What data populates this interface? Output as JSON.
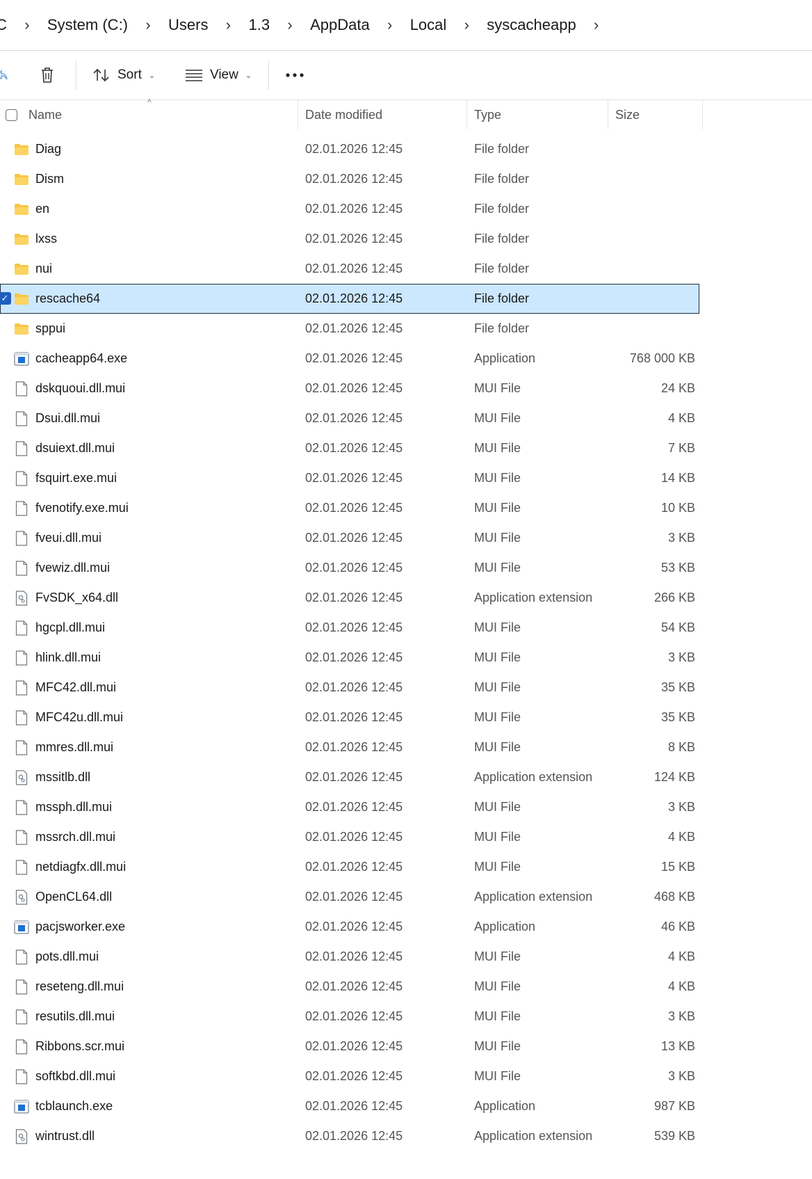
{
  "breadcrumb": {
    "cut_fragment": "C",
    "items": [
      "System (C:)",
      "Users",
      "1.3",
      "AppData",
      "Local",
      "syscacheapp"
    ]
  },
  "toolbar": {
    "sort_label": "Sort",
    "view_label": "View"
  },
  "columns": {
    "name": "Name",
    "date": "Date modified",
    "type": "Type",
    "size": "Size"
  },
  "files": [
    {
      "name": "Diag",
      "date": "02.01.2026 12:45",
      "type": "File folder",
      "size": "",
      "icon": "folder-icon"
    },
    {
      "name": "Dism",
      "date": "02.01.2026 12:45",
      "type": "File folder",
      "size": "",
      "icon": "folder-icon"
    },
    {
      "name": "en",
      "date": "02.01.2026 12:45",
      "type": "File folder",
      "size": "",
      "icon": "folder-icon"
    },
    {
      "name": "lxss",
      "date": "02.01.2026 12:45",
      "type": "File folder",
      "size": "",
      "icon": "folder-icon"
    },
    {
      "name": "nui",
      "date": "02.01.2026 12:45",
      "type": "File folder",
      "size": "",
      "icon": "folder-icon"
    },
    {
      "name": "rescache64",
      "date": "02.01.2026 12:45",
      "type": "File folder",
      "size": "",
      "icon": "folder-icon",
      "selected": true
    },
    {
      "name": "sppui",
      "date": "02.01.2026 12:45",
      "type": "File folder",
      "size": "",
      "icon": "folder-icon"
    },
    {
      "name": "cacheapp64.exe",
      "date": "02.01.2026 12:45",
      "type": "Application",
      "size": "768 000 KB",
      "icon": "application-icon"
    },
    {
      "name": "dskquoui.dll.mui",
      "date": "02.01.2026 12:45",
      "type": "MUI File",
      "size": "24 KB",
      "icon": "file-icon"
    },
    {
      "name": "Dsui.dll.mui",
      "date": "02.01.2026 12:45",
      "type": "MUI File",
      "size": "4 KB",
      "icon": "file-icon"
    },
    {
      "name": "dsuiext.dll.mui",
      "date": "02.01.2026 12:45",
      "type": "MUI File",
      "size": "7 KB",
      "icon": "file-icon"
    },
    {
      "name": "fsquirt.exe.mui",
      "date": "02.01.2026 12:45",
      "type": "MUI File",
      "size": "14 KB",
      "icon": "file-icon"
    },
    {
      "name": "fvenotify.exe.mui",
      "date": "02.01.2026 12:45",
      "type": "MUI File",
      "size": "10 KB",
      "icon": "file-icon"
    },
    {
      "name": "fveui.dll.mui",
      "date": "02.01.2026 12:45",
      "type": "MUI File",
      "size": "3 KB",
      "icon": "file-icon"
    },
    {
      "name": "fvewiz.dll.mui",
      "date": "02.01.2026 12:45",
      "type": "MUI File",
      "size": "53 KB",
      "icon": "file-icon"
    },
    {
      "name": "FvSDK_x64.dll",
      "date": "02.01.2026 12:45",
      "type": "Application extension",
      "size": "266 KB",
      "icon": "dll-icon"
    },
    {
      "name": "hgcpl.dll.mui",
      "date": "02.01.2026 12:45",
      "type": "MUI File",
      "size": "54 KB",
      "icon": "file-icon"
    },
    {
      "name": "hlink.dll.mui",
      "date": "02.01.2026 12:45",
      "type": "MUI File",
      "size": "3 KB",
      "icon": "file-icon"
    },
    {
      "name": "MFC42.dll.mui",
      "date": "02.01.2026 12:45",
      "type": "MUI File",
      "size": "35 KB",
      "icon": "file-icon"
    },
    {
      "name": "MFC42u.dll.mui",
      "date": "02.01.2026 12:45",
      "type": "MUI File",
      "size": "35 KB",
      "icon": "file-icon"
    },
    {
      "name": "mmres.dll.mui",
      "date": "02.01.2026 12:45",
      "type": "MUI File",
      "size": "8 KB",
      "icon": "file-icon"
    },
    {
      "name": "mssitlb.dll",
      "date": "02.01.2026 12:45",
      "type": "Application extension",
      "size": "124 KB",
      "icon": "dll-icon"
    },
    {
      "name": "mssph.dll.mui",
      "date": "02.01.2026 12:45",
      "type": "MUI File",
      "size": "3 KB",
      "icon": "file-icon"
    },
    {
      "name": "mssrch.dll.mui",
      "date": "02.01.2026 12:45",
      "type": "MUI File",
      "size": "4 KB",
      "icon": "file-icon"
    },
    {
      "name": "netdiagfx.dll.mui",
      "date": "02.01.2026 12:45",
      "type": "MUI File",
      "size": "15 KB",
      "icon": "file-icon"
    },
    {
      "name": "OpenCL64.dll",
      "date": "02.01.2026 12:45",
      "type": "Application extension",
      "size": "468 KB",
      "icon": "dll-icon"
    },
    {
      "name": "pacjsworker.exe",
      "date": "02.01.2026 12:45",
      "type": "Application",
      "size": "46 KB",
      "icon": "application-icon"
    },
    {
      "name": "pots.dll.mui",
      "date": "02.01.2026 12:45",
      "type": "MUI File",
      "size": "4 KB",
      "icon": "file-icon"
    },
    {
      "name": "reseteng.dll.mui",
      "date": "02.01.2026 12:45",
      "type": "MUI File",
      "size": "4 KB",
      "icon": "file-icon"
    },
    {
      "name": "resutils.dll.mui",
      "date": "02.01.2026 12:45",
      "type": "MUI File",
      "size": "3 KB",
      "icon": "file-icon"
    },
    {
      "name": "Ribbons.scr.mui",
      "date": "02.01.2026 12:45",
      "type": "MUI File",
      "size": "13 KB",
      "icon": "file-icon"
    },
    {
      "name": "softkbd.dll.mui",
      "date": "02.01.2026 12:45",
      "type": "MUI File",
      "size": "3 KB",
      "icon": "file-icon"
    },
    {
      "name": "tcblaunch.exe",
      "date": "02.01.2026 12:45",
      "type": "Application",
      "size": "987 KB",
      "icon": "application-icon"
    },
    {
      "name": "wintrust.dll",
      "date": "02.01.2026 12:45",
      "type": "Application extension",
      "size": "539 KB",
      "icon": "dll-icon"
    }
  ],
  "colors": {
    "selection_bg": "#cce8ff",
    "selection_border": "#1f2d3d",
    "checkbox_accent": "#1f5fbf",
    "folder_yellow": "#f8c545"
  }
}
